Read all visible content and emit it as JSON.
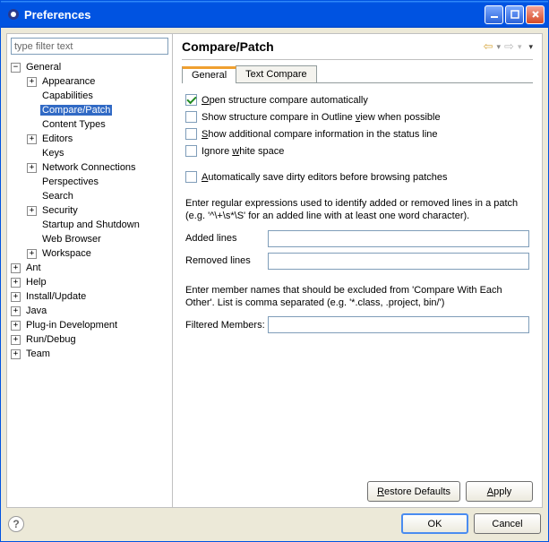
{
  "window": {
    "title": "Preferences"
  },
  "filter": {
    "placeholder": "type filter text"
  },
  "tree": [
    {
      "label": "General",
      "depth": 0,
      "exp": "-",
      "children": [
        {
          "label": "Appearance",
          "depth": 1,
          "exp": "+"
        },
        {
          "label": "Capabilities",
          "depth": 1,
          "exp": ""
        },
        {
          "label": "Compare/Patch",
          "depth": 1,
          "exp": "",
          "selected": true
        },
        {
          "label": "Content Types",
          "depth": 1,
          "exp": ""
        },
        {
          "label": "Editors",
          "depth": 1,
          "exp": "+"
        },
        {
          "label": "Keys",
          "depth": 1,
          "exp": ""
        },
        {
          "label": "Network Connections",
          "depth": 1,
          "exp": "+"
        },
        {
          "label": "Perspectives",
          "depth": 1,
          "exp": ""
        },
        {
          "label": "Search",
          "depth": 1,
          "exp": ""
        },
        {
          "label": "Security",
          "depth": 1,
          "exp": "+"
        },
        {
          "label": "Startup and Shutdown",
          "depth": 1,
          "exp": ""
        },
        {
          "label": "Web Browser",
          "depth": 1,
          "exp": ""
        },
        {
          "label": "Workspace",
          "depth": 1,
          "exp": "+"
        }
      ]
    },
    {
      "label": "Ant",
      "depth": 0,
      "exp": "+"
    },
    {
      "label": "Help",
      "depth": 0,
      "exp": "+"
    },
    {
      "label": "Install/Update",
      "depth": 0,
      "exp": "+"
    },
    {
      "label": "Java",
      "depth": 0,
      "exp": "+"
    },
    {
      "label": "Plug-in Development",
      "depth": 0,
      "exp": "+"
    },
    {
      "label": "Run/Debug",
      "depth": 0,
      "exp": "+"
    },
    {
      "label": "Team",
      "depth": 0,
      "exp": "+"
    }
  ],
  "page": {
    "title": "Compare/Patch",
    "tabs": {
      "general": "General",
      "text_compare": "Text Compare"
    },
    "checkboxes": {
      "open_structure": {
        "pre": "",
        "u": "O",
        "post": "pen structure compare automatically",
        "checked": true
      },
      "show_outline": {
        "pre": "Show structure compare in Outline ",
        "u": "v",
        "post": "iew when possible",
        "checked": false
      },
      "show_additional": {
        "pre": "",
        "u": "S",
        "post": "how additional compare information in the status line",
        "checked": false
      },
      "ignore_ws": {
        "pre": "Ignore ",
        "u": "w",
        "post": "hite space",
        "checked": false
      },
      "auto_save": {
        "pre": "",
        "u": "A",
        "post": "utomatically save dirty editors before browsing patches",
        "checked": false
      }
    },
    "regex_desc": "Enter regular expressions used to identify added or removed lines in a patch (e.g. '^\\+\\s*\\S' for an added line with at least one word character).",
    "added_label": "Added lines",
    "removed_label": "Removed lines",
    "added_value": "",
    "removed_value": "",
    "exclude_desc": "Enter member names that should be excluded from 'Compare With Each Other'. List is comma separated (e.g. '*.class, .project, bin/')",
    "filtered_label": "Filtered Members:",
    "filtered_value": ""
  },
  "buttons": {
    "restore": "Restore Defaults",
    "apply": "Apply",
    "ok": "OK",
    "cancel": "Cancel"
  }
}
